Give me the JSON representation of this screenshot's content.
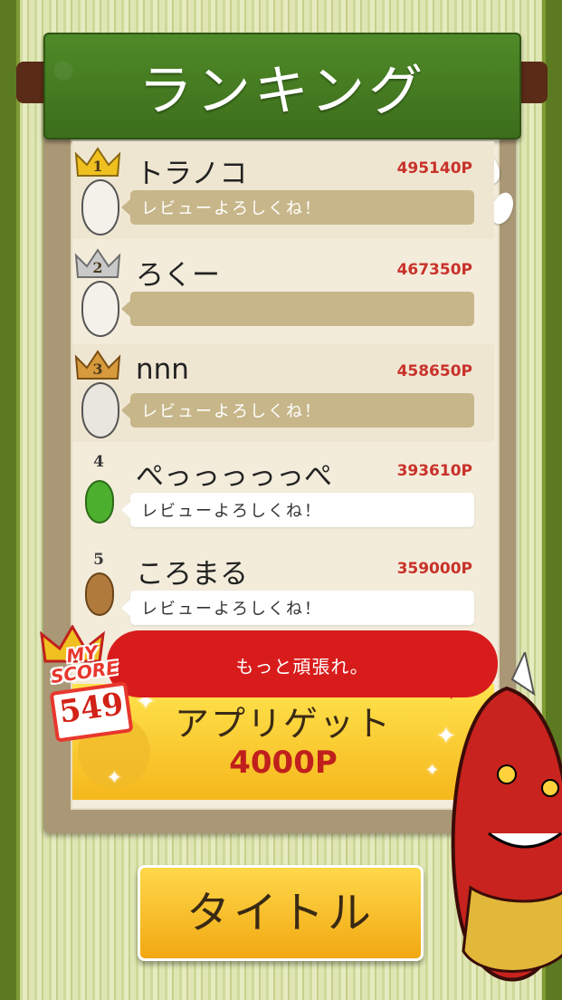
{
  "header": {
    "title": "ランキング"
  },
  "ranking": [
    {
      "rank": "1",
      "name": "トラノコ",
      "score": "495140P",
      "comment": "レビューよろしくね！"
    },
    {
      "rank": "2",
      "name": "ろくー",
      "score": "467350P",
      "comment": ""
    },
    {
      "rank": "3",
      "name": "nnn",
      "score": "458650P",
      "comment": "レビューよろしくね！"
    },
    {
      "rank": "4",
      "name": "ぺっっっっっぺ",
      "score": "393610P",
      "comment": "レビューよろしくね！"
    },
    {
      "rank": "5",
      "name": "ころまる",
      "score": "359000P",
      "comment": "レビューよろしくね！"
    }
  ],
  "my_score": {
    "label_line1": "MY",
    "label_line2": "SCORE",
    "value": "549"
  },
  "message": "もっと頑張れ。",
  "reward": {
    "label": "アプリゲット",
    "points": "4000P"
  },
  "title_button": "タイトル",
  "colors": {
    "header_green": "#3c6e1b",
    "score_red": "#c8322a",
    "bubble_red": "#d81c1c",
    "gold": "#f5b71c"
  }
}
